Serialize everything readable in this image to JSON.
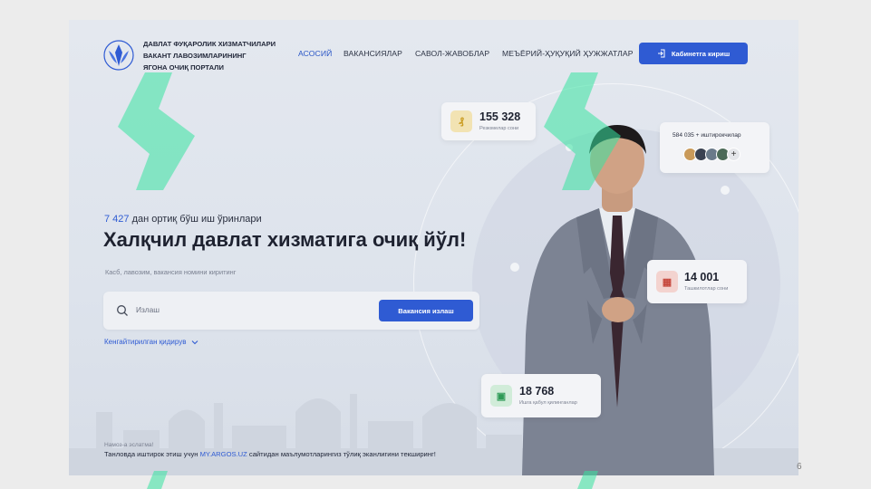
{
  "header": {
    "portal_name": [
      "ДАВЛАТ ФУҚАРОЛИК ХИЗМАТЧИЛАРИ",
      "ВАКАНТ ЛАВОЗИМЛАРИНИНГ",
      "ЯГОНА ОЧИҚ ПОРТАЛИ"
    ],
    "nav": [
      {
        "label": "АСОСИЙ",
        "active": true
      },
      {
        "label": "ВАКАНСИЯЛАР",
        "active": false
      },
      {
        "label": "САВОЛ-ЖАВОБЛАР",
        "active": false
      },
      {
        "label": "МЕЪЁРИЙ-ҲУҚУҚИЙ ҲУЖЖАТЛАР",
        "active": false
      }
    ],
    "cabinet_button": "Кабинетга кириш"
  },
  "hero": {
    "jobs_count": "7 427",
    "jobs_suffix": " дан ортиқ бўш иш ўринлари",
    "headline": "Халқчил давлат хизматига очиқ йўл!",
    "hint": "Касб, лавозим, вакансия номини киритинг",
    "search_placeholder": "Излаш",
    "search_button": "Вакансия излаш",
    "advanced_search": "Кенгайтирилган қидирув"
  },
  "stats": {
    "resumes": {
      "value": "155 328",
      "label": "Резюмелар сони"
    },
    "participants": {
      "label": "584 035 + иштирокчилар"
    },
    "organizations": {
      "value": "14 001",
      "label": "Ташкилотлар сони"
    },
    "hired": {
      "value": "18 768",
      "label": "Ишга қабул қилинганлар"
    }
  },
  "notice": {
    "title": "Намоз-а эслатма!",
    "prefix": "Танловда иштирок этиш учун ",
    "link": "MY.ARGOS.UZ",
    "suffix": " сайтидан маълумотларингиз тўлиқ эканлигини текширинг!"
  },
  "page_number": "6",
  "colors": {
    "accent": "#2f5bd3",
    "text": "#1e2230",
    "watermark": "#37e3a0"
  }
}
